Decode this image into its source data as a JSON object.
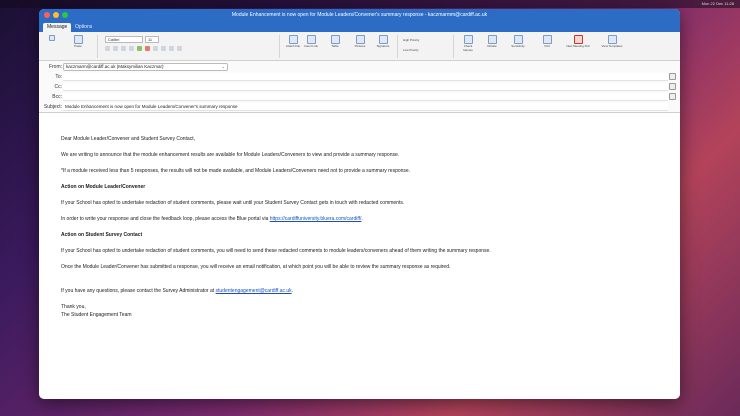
{
  "menubar": {
    "clock": "Mon 22 Dec 11:28"
  },
  "window": {
    "title": "Module Enhancement is now open for Module Leaders/Convener's summary response - kaczmarmm@cardiff.ac.uk"
  },
  "tabs": [
    "Message",
    "Options"
  ],
  "ribbon": {
    "paste": "Paste",
    "font": "Calibri",
    "size": "11",
    "attach_file": "Attach File",
    "insert_link": "Insert Link",
    "table": "Table",
    "pictures": "Pictures",
    "signature": "Signature",
    "high_priority": "High Priority",
    "low_priority": "Low Priority",
    "check_names": "Check Names",
    "dictate": "Dictate",
    "sensitivity": "Sensitivity",
    "poll": "Poll",
    "new_meeting": "New Meeting Poll",
    "view_templates": "View Templates"
  },
  "headers": {
    "from_label": "From:",
    "from_value": "kaczmarm@cardiff.ac.uk (Maksymilian Kaczmar)",
    "to_label": "To:",
    "cc_label": "Cc:",
    "bcc_label": "Bcc:",
    "subject_label": "Subject:",
    "subject_value": "Module Enhancement is now open for Module Leaders/Convener's summary response"
  },
  "body": {
    "greeting": "Dear Module Leader/Convener and Student Survey Contact,",
    "p1": "We are writing to announce that the module enhancement results are available for Module Leaders/Conveners to view and provide a summary response.",
    "p2": "*If a module received less than 5 responses, the results will not be made available, and Module Leaders/Conveners need not to provide a summary response.",
    "h1": "Action on Module Leader/Convener",
    "p3": "If your School has opted to undertake redaction of student comments, please wait until your Student Survey Contact gets in touch with redacted comments.",
    "p4_pre": "In order to write your response and close the feedback loop, please access the Blue portal via ",
    "p4_link": "https://cardiffuniversity.bluera.com/cardiff/",
    "p4_post": ".",
    "h2": "Action on Student Survey Contact",
    "p5": "If your School has opted to undertake redaction of student comments, you will need to send these redacted comments to module leaders/conveners ahead of them writing the summary response.",
    "p6": "Once the Module Leader/Convener has submitted a response, you will receive an email notification, at which point you will be able to review the summary response as required.",
    "p7_pre": "If you have any questions, please contact the Survey Administrator at ",
    "p7_link": "studentengagement@cardiff.ac.uk",
    "p7_post": ".",
    "signoff": "Thank you,",
    "signature": "The Student Engagement Team"
  },
  "colors": {
    "accent": "#2c6cc4",
    "link": "#1a4fbf"
  }
}
